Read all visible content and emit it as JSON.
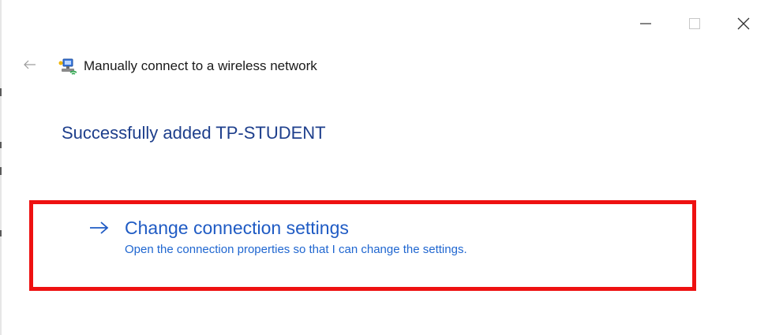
{
  "window": {
    "controls": {
      "minimize_icon": "minimize-icon",
      "maximize_icon": "maximize-icon",
      "close_icon": "close-icon"
    }
  },
  "header": {
    "back_icon": "back-arrow-icon",
    "network_icon": "wireless-network-icon",
    "title": "Manually connect to a wireless network"
  },
  "main": {
    "instruction": "Successfully added TP-STUDENT",
    "command_link": {
      "icon": "arrow-right-icon",
      "title": "Change connection settings",
      "note": "Open the connection properties so that I can change the settings."
    }
  },
  "colors": {
    "instruction_text": "#1e3f8c",
    "link_text": "#1f5bc4",
    "highlight_border": "#ee1111"
  }
}
